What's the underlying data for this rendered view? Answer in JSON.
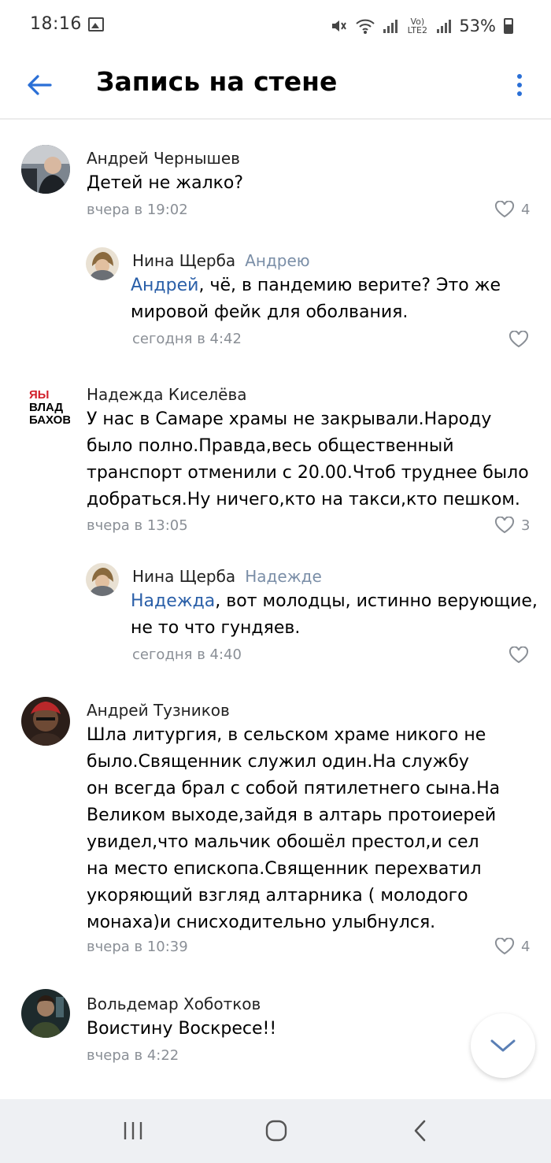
{
  "status_bar": {
    "time": "18:16",
    "battery_percent": "53%",
    "network": "Vo) LTE2",
    "icons": [
      "gallery-icon",
      "mute-icon",
      "wifi-icon",
      "signal-icon",
      "signal-icon",
      "battery-icon"
    ]
  },
  "header": {
    "title": "Запись на стене",
    "back_icon": "arrow-left-icon",
    "more_icon": "more-vertical-icon",
    "accent_color": "#2a6fd6"
  },
  "comments": [
    {
      "author": "Андрей Чернышев",
      "text": [
        "Детей не жалко?"
      ],
      "time": "вчера в 19:02",
      "likes": "4"
    },
    {
      "author": "Нина Щерба",
      "reply_to": "Андрею",
      "mention": "Андрей",
      "text_first_rest": ", чё, в пандемию верите? Это же",
      "text": [
        "мировой фейк для оболвания."
      ],
      "time": "сегодня в 4:42",
      "likes": ""
    },
    {
      "author": "Надежда Киселёва",
      "avatar_text": [
        "ЯЫ",
        "ВЛАД",
        "БАХОВ"
      ],
      "text": [
        "У нас в Самаре храмы не закрывали.Народу",
        "было полно.Правда,весь общественный",
        "транспорт отменили с 20.00.Чтоб труднее было",
        "добраться.Ну ничего,кто на такси,кто пешком."
      ],
      "time": "вчера в 13:05",
      "likes": "3"
    },
    {
      "author": "Нина Щерба",
      "reply_to": "Надежде",
      "mention": "Надежда",
      "text_first_rest": ", вот молодцы, истинно верующие,",
      "text": [
        "не то что гундяев."
      ],
      "time": "сегодня в 4:40",
      "likes": ""
    },
    {
      "author": "Андрей Тузников",
      "text": [
        "Шла литургия, в сельском храме никого не",
        "было.Священник служил один.На службу",
        "он всегда брал с собой пятилетнего сына.На",
        "Великом выходе,зайдя в алтарь протоиерей",
        "увидел,что мальчик обошёл престол,и сел",
        "на место епископа.Священник  перехватил",
        "укоряющий взгляд алтарника ( молодого",
        "монаха)и снисходительно улыбнулся."
      ],
      "time": "вчера в 10:39",
      "likes": "4"
    },
    {
      "author": "Вольдемар Хоботков",
      "text": [
        "Воистину Воскресе!!"
      ],
      "time": "вчера в 4:22",
      "likes": ""
    }
  ],
  "fab_icon": "chevron-down-icon",
  "nav_icons": [
    "recent-apps-icon",
    "home-icon",
    "back-icon"
  ]
}
